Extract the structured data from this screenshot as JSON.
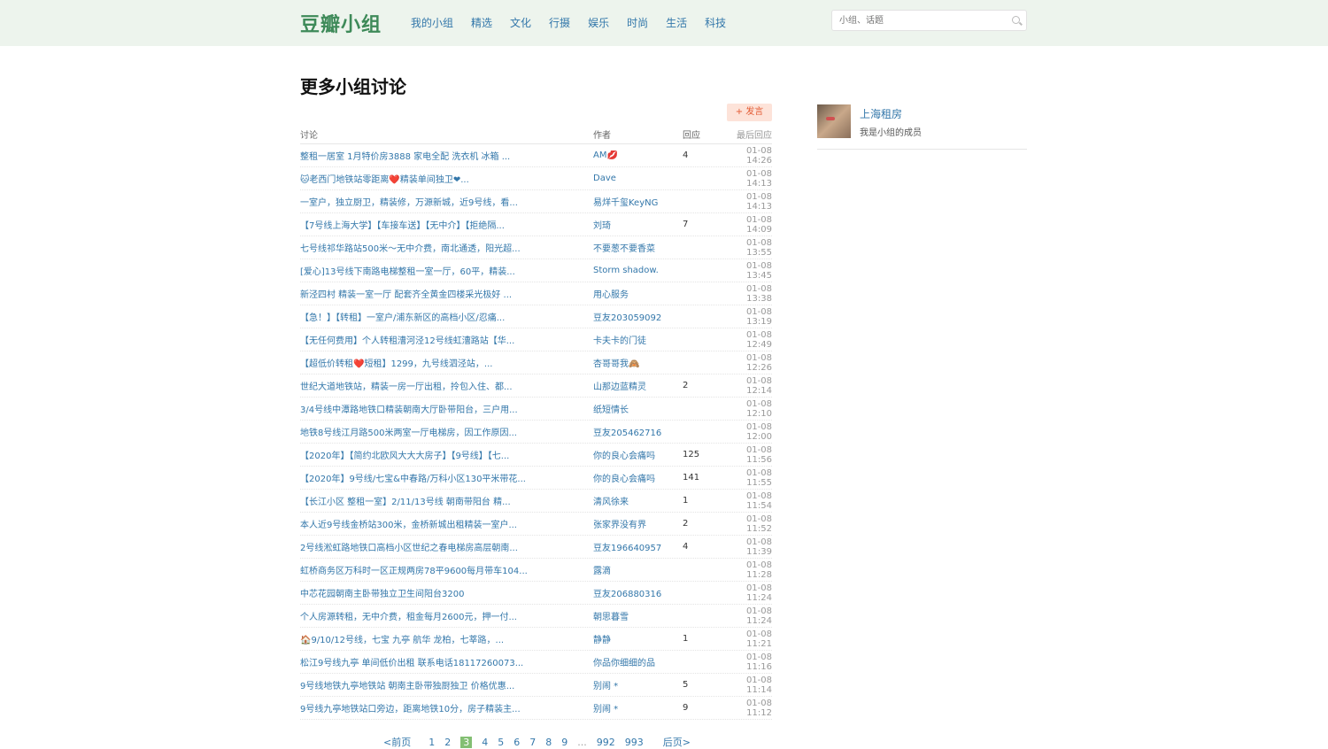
{
  "header": {
    "logo": "豆瓣小组",
    "nav": [
      "我的小组",
      "精选",
      "文化",
      "行摄",
      "娱乐",
      "时尚",
      "生活",
      "科技"
    ],
    "search_placeholder": "小组、话题"
  },
  "main": {
    "title": "更多小组讨论",
    "post_button": "+ 发言",
    "columns": [
      "讨论",
      "作者",
      "回应",
      "最后回应"
    ],
    "rows": [
      {
        "title": "整租一居室 1月特价房3888 家电全配 洗衣机 冰箱 ...",
        "author": "AM💋",
        "replies": "4",
        "time": "01-08 14:26"
      },
      {
        "title": "🐱老西门地铁站零距离❤️精装单间独卫❤...",
        "author": "Dave",
        "replies": "",
        "time": "01-08 14:13"
      },
      {
        "title": "一室户，独立厨卫，精装修，万源新城，近9号线，看...",
        "author": "易烊千玺KeyNG",
        "replies": "",
        "time": "01-08 14:13"
      },
      {
        "title": "【7号线上海大学】【车接车送】【无中介】【拒绝隔...",
        "author": "刘琦",
        "replies": "7",
        "time": "01-08 14:09"
      },
      {
        "title": "七号线祁华路站500米～无中介费，南北通透，阳光超...",
        "author": "不要葱不要香菜",
        "replies": "",
        "time": "01-08 13:55"
      },
      {
        "title": "[爱心]13号线下南路电梯整租一室一厅，60平，精装...",
        "author": "Storm shadow.",
        "replies": "",
        "time": "01-08 13:45"
      },
      {
        "title": "新泾四村 精装一室一厅 配套齐全黄金四楼采光极好 ...",
        "author": "用心服务",
        "replies": "",
        "time": "01-08 13:38"
      },
      {
        "title": "【急！】【转租】一室户/浦东新区的高档小区/忍痛...",
        "author": "豆友203059092",
        "replies": "",
        "time": "01-08 13:19"
      },
      {
        "title": "【无任何费用】个人转租漕河泾12号线虹漕路站【华...",
        "author": "卡夫卡的门徒",
        "replies": "",
        "time": "01-08 12:49"
      },
      {
        "title": "【超低价转租❤️短租】1299，九号线泗泾站，...",
        "author": "杏哥哥我🙈",
        "replies": "",
        "time": "01-08 12:26"
      },
      {
        "title": "世纪大道地铁站，精装一房一厅出租，拎包入住、都...",
        "author": "山那边蓝精灵",
        "replies": "2",
        "time": "01-08 12:14"
      },
      {
        "title": "3/4号线中潭路地铁口精装朝南大厅卧带阳台，三户用...",
        "author": "纸短情长",
        "replies": "",
        "time": "01-08 12:10"
      },
      {
        "title": "地铁8号线江月路500米两室一厅电梯房，因工作原因...",
        "author": "豆友205462716",
        "replies": "",
        "time": "01-08 12:00"
      },
      {
        "title": "【2020年】【简约北欧风大大大房子】【9号线】【七...",
        "author": "你的良心会痛吗",
        "replies": "125",
        "time": "01-08 11:56"
      },
      {
        "title": "【2020年】9号线/七宝&中春路/万科小区130平米带花...",
        "author": "你的良心会痛吗",
        "replies": "141",
        "time": "01-08 11:55"
      },
      {
        "title": "【长江小区 整租一室】2/11/13号线 朝南带阳台 精...",
        "author": "清风徐来",
        "replies": "1",
        "time": "01-08 11:54"
      },
      {
        "title": "本人近9号线金桥站300米，金桥新城出租精装一室户...",
        "author": "张家界没有界",
        "replies": "2",
        "time": "01-08 11:52"
      },
      {
        "title": "2号线淞虹路地铁口高档小区世纪之春电梯房高层朝南...",
        "author": "豆友196640957",
        "replies": "4",
        "time": "01-08 11:39"
      },
      {
        "title": "虹桥商务区万科时一区正规两房78平9600每月带车104...",
        "author": "露滴",
        "replies": "",
        "time": "01-08 11:28"
      },
      {
        "title": "中芯花园朝南主卧带独立卫生间阳台3200",
        "author": "豆友206880316",
        "replies": "",
        "time": "01-08 11:24"
      },
      {
        "title": "个人房源转租，无中介费，租金每月2600元，押一付...",
        "author": "朝思暮雪",
        "replies": "",
        "time": "01-08 11:24"
      },
      {
        "title": "🏠9/10/12号线，七宝 九亭 航华 龙柏，七莘路，...",
        "author": "静静",
        "replies": "1",
        "time": "01-08 11:21"
      },
      {
        "title": "松江9号线九亭 单间低价出租 联系电话18117260073...",
        "author": "你品你细细的品",
        "replies": "",
        "time": "01-08 11:16"
      },
      {
        "title": "9号线地铁九亭地铁站 朝南主卧带独厨独卫 价格优惠...",
        "author": "别闹  *",
        "replies": "5",
        "time": "01-08 11:14"
      },
      {
        "title": "9号线九亭地铁站口旁边，距离地铁10分，房子精装主...",
        "author": "别闹  *",
        "replies": "9",
        "time": "01-08 11:12"
      }
    ],
    "pager": {
      "prev": "<前页",
      "pages": [
        "1",
        "2",
        "3",
        "4",
        "5",
        "6",
        "7",
        "8",
        "9"
      ],
      "current": "3",
      "ellipsis": "...",
      "tail": [
        "992",
        "993"
      ],
      "next": "后页>"
    }
  },
  "sidebar": {
    "group_name": "上海租房",
    "member_status": "我是小组的成员"
  }
}
